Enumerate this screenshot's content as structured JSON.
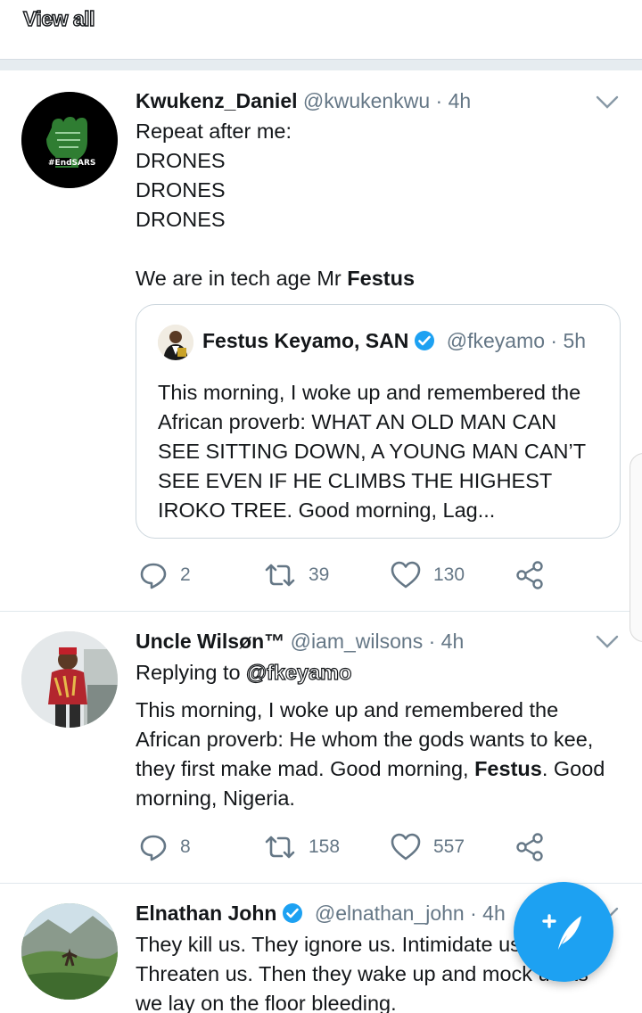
{
  "top": {
    "view_all": "View all"
  },
  "tweets": [
    {
      "name": "Kwukenz_Daniel",
      "handle": "@kwukenkwu",
      "time": "· 4h",
      "lines": [
        "Repeat after me:",
        "DRONES",
        "DRONES",
        "DRONES",
        "",
        "We are in tech age Mr "
      ],
      "bold_tail": "Festus",
      "avatar_text": "#EndSARS",
      "quote": {
        "name": "Festus Keyamo, SAN",
        "handle": "@fkeyamo",
        "time": "· 5h",
        "text": "This morning, I woke up and remembered the African proverb: WHAT AN OLD MAN CAN SEE SITTING DOWN, A YOUNG MAN CAN’T SEE EVEN IF HE CLIMBS THE HIGHEST IROKO TREE. Good morning, Lag..."
      },
      "replies": "2",
      "retweets": "39",
      "likes": "130"
    },
    {
      "name": "Uncle Wilsøn™",
      "handle": "@iam_wilsons",
      "time": "· 4h",
      "replying_prefix": "Replying to ",
      "replying_to": "@fkeyamo",
      "text_a": "This morning, I woke up and remembered the African proverb: He whom the gods wants to kee, they first make mad. Good morning, ",
      "bold": "Festus",
      "text_b": ". Good morning, Nigeria.",
      "replies": "8",
      "retweets": "158",
      "likes": "557"
    },
    {
      "name": "Elnathan John",
      "handle": "@elnathan_john",
      "time": "· 4h",
      "text": "They kill us. They ignore us. Intimidate us. Threaten us. Then they wake up and mock us as we lay on the floor bleeding."
    }
  ],
  "colors": {
    "accent": "#1da1f2",
    "secondary_text": "#657786",
    "separator": "#e6ecf0"
  },
  "icons": [
    "reply-icon",
    "retweet-icon",
    "like-icon",
    "share-icon",
    "chevron-down-icon",
    "verified-icon",
    "compose-tweet-icon"
  ]
}
